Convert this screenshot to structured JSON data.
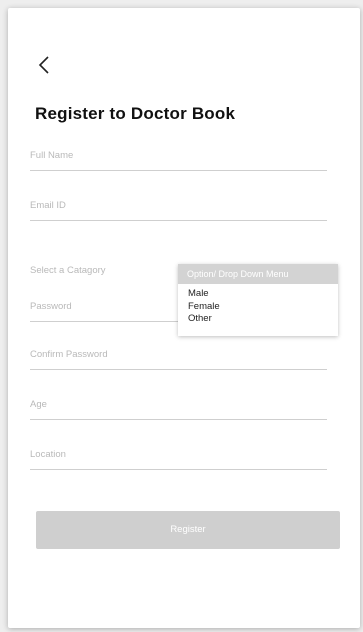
{
  "header": {
    "back_icon": "chevron-left-icon",
    "title": "Register to Doctor Book"
  },
  "form": {
    "full_name_placeholder": "Full Name",
    "email_placeholder": "Email ID",
    "category_label": "Select a Catagory",
    "password_placeholder": "Password",
    "confirm_password_placeholder": "Confirm Password",
    "age_placeholder": "Age",
    "location_placeholder": "Location"
  },
  "dropdown": {
    "header": "Option/ Drop Down Menu",
    "options": [
      "Male",
      "Female",
      "Other"
    ]
  },
  "register_button": {
    "label": "Register",
    "color": "#cfcfcf"
  }
}
